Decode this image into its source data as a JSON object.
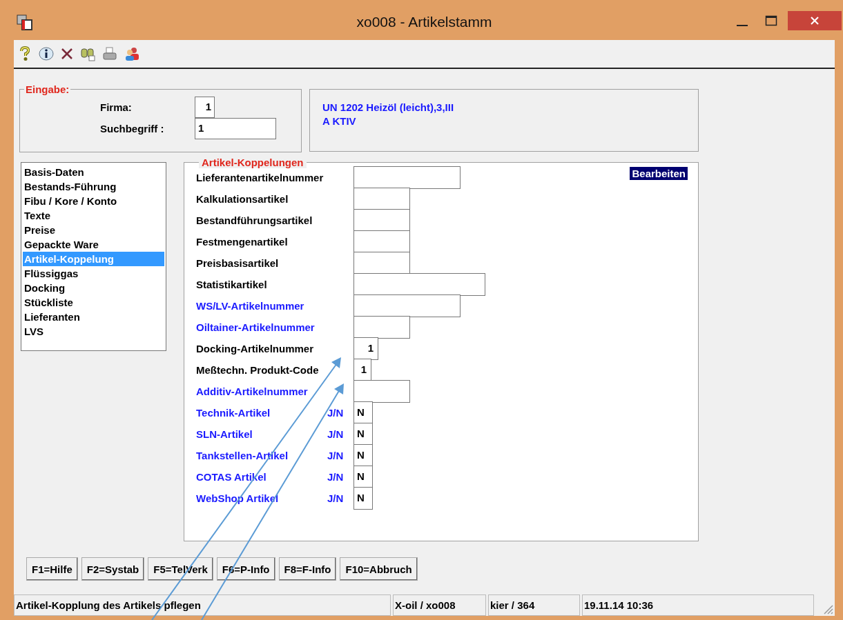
{
  "window": {
    "title": "xo008 - Artikelstamm"
  },
  "input_group": {
    "title": "Eingabe:",
    "fields": [
      {
        "label": "Firma:",
        "value": "1",
        "kind": "code"
      },
      {
        "label": "Suchbegriff :",
        "value": "1",
        "kind": "long"
      }
    ]
  },
  "info": {
    "lines": [
      "UN 1202 Heizöl (leicht),3,III",
      "A KTIV"
    ]
  },
  "sidebar": {
    "items": [
      {
        "label": "Basis-Daten",
        "selected": false
      },
      {
        "label": "Bestands-Führung",
        "selected": false
      },
      {
        "label": "Fibu / Kore / Konto",
        "selected": false
      },
      {
        "label": "Texte",
        "selected": false
      },
      {
        "label": "Preise",
        "selected": false
      },
      {
        "label": "Gepackte Ware",
        "selected": false
      },
      {
        "label": "Artikel-Koppelung",
        "selected": true
      },
      {
        "label": "Flüssiggas",
        "selected": false
      },
      {
        "label": "Docking",
        "selected": false
      },
      {
        "label": "Stückliste",
        "selected": false
      },
      {
        "label": "Lieferanten",
        "selected": false
      },
      {
        "label": "LVS",
        "selected": false
      }
    ]
  },
  "panel": {
    "title": "Artikel-Koppelungen",
    "mode": "Bearbeiten",
    "fields": [
      {
        "label": "Lieferantenartikelnummer",
        "color": "#000000",
        "kind": "long"
      },
      {
        "label": "Kalkulationsartikel",
        "color": "#000000",
        "kind": "short"
      },
      {
        "label": "Bestandführungsartikel",
        "color": "#000000",
        "kind": "short"
      },
      {
        "label": "Festmengenartikel",
        "color": "#000000",
        "kind": "short"
      },
      {
        "label": "Preisbasisartikel",
        "color": "#000000",
        "kind": "short"
      },
      {
        "label": "Statistikartikel",
        "color": "#000000",
        "kind": "wide"
      },
      {
        "label": "WS/LV-Artikelnummer",
        "color": "#1a1aff",
        "kind": "long"
      },
      {
        "label": "Oiltainer-Artikelnummer",
        "color": "#1a1aff",
        "kind": "short"
      },
      {
        "label": "Docking-Artikelnummer",
        "color": "#000000",
        "kind": "code",
        "value": "1"
      },
      {
        "label": "Meßtechn. Produkt-Code",
        "color": "#000000",
        "kind": "digit",
        "value": "1"
      },
      {
        "label": "Additiv-Artikelnummer",
        "color": "#1a1aff",
        "kind": "short"
      },
      {
        "label": "Technik-Artikel",
        "color": "#1a1aff",
        "kind": "flag",
        "hint": "J/N",
        "value": "N"
      },
      {
        "label": "SLN-Artikel",
        "color": "#1a1aff",
        "kind": "flag",
        "hint": "J/N",
        "value": "N"
      },
      {
        "label": "Tankstellen-Artikel",
        "color": "#1a1aff",
        "kind": "flag",
        "hint": "J/N",
        "value": "N"
      },
      {
        "label": "COTAS Artikel",
        "color": "#1a1aff",
        "kind": "flag",
        "hint": "J/N",
        "value": "N"
      },
      {
        "label": "WebShop Artikel",
        "color": "#1a1aff",
        "kind": "flag",
        "hint": "J/N",
        "value": "N"
      }
    ]
  },
  "buttons": [
    "F1=Hilfe",
    "F2=Systab",
    "F5=TelVerk",
    "F6=P-Info",
    "F8=F-Info",
    "F10=Abbruch"
  ],
  "status_bar": [
    "Artikel-Kopplung des Artikels pflegen",
    "X-oil / xo008",
    "kier / 364",
    "19.11.14 10:36"
  ]
}
